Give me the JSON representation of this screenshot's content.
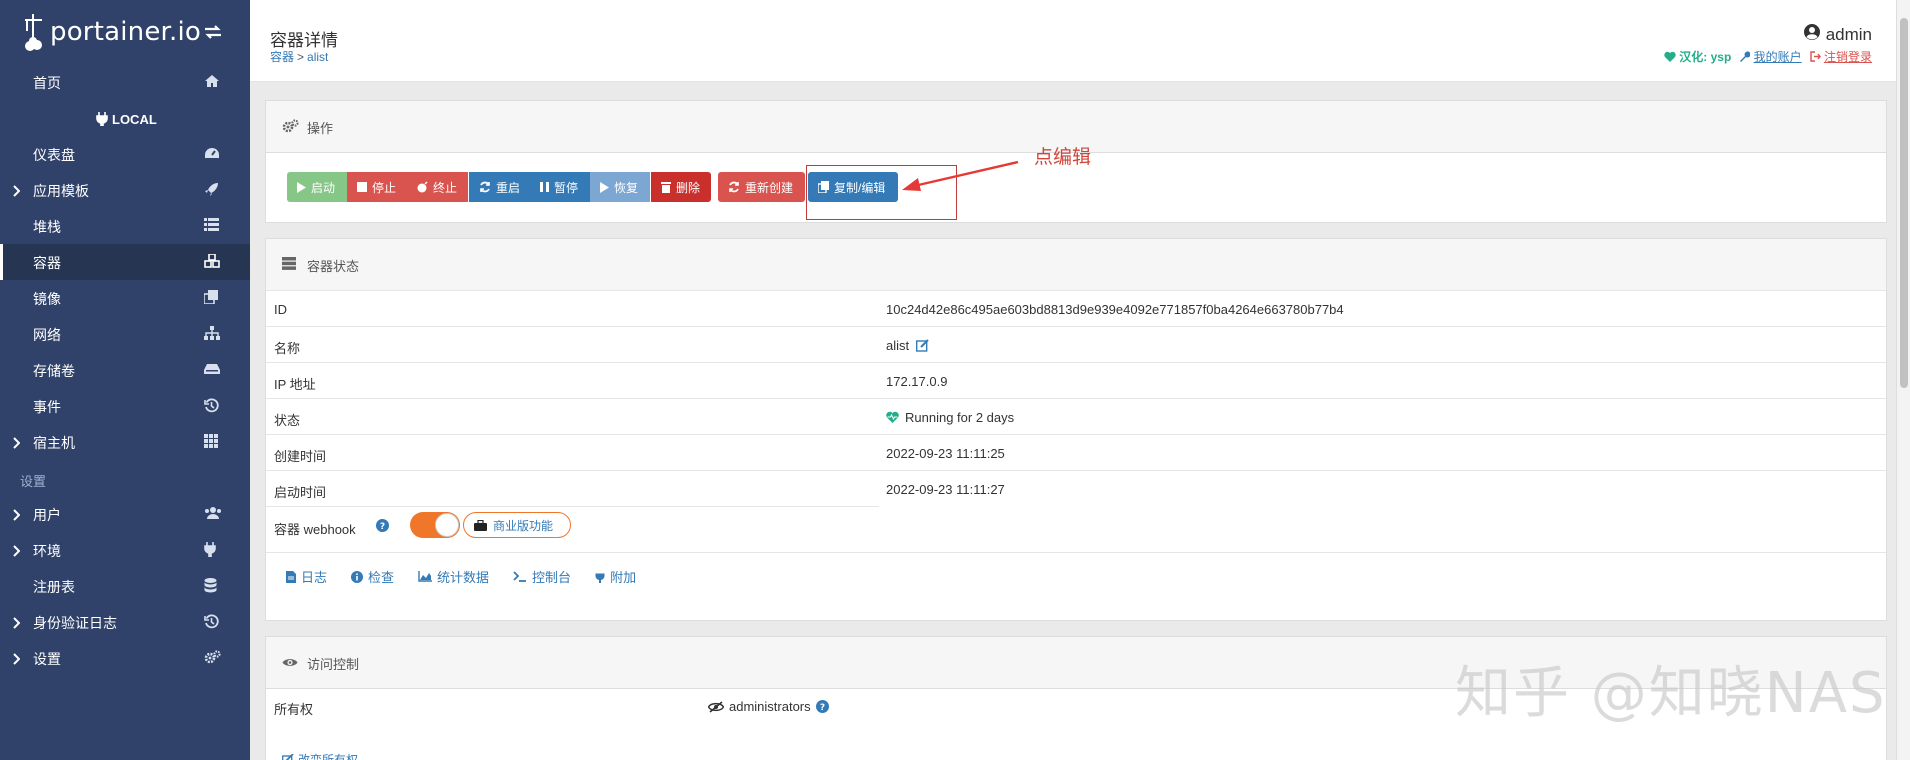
{
  "sidebar": {
    "logo_text": "portainer.io",
    "items_top": [
      {
        "label": "首页",
        "icon": "home-icon"
      }
    ],
    "endpoint_header": "LOCAL",
    "items": [
      {
        "label": "仪表盘",
        "icon": "dashboard-icon",
        "caret": false
      },
      {
        "label": "应用模板",
        "icon": "rocket-icon",
        "caret": true
      },
      {
        "label": "堆栈",
        "icon": "list-icon",
        "caret": false
      },
      {
        "label": "容器",
        "icon": "cubes-icon",
        "caret": false,
        "active": true
      },
      {
        "label": "镜像",
        "icon": "clone-icon",
        "caret": false
      },
      {
        "label": "网络",
        "icon": "sitemap-icon",
        "caret": false
      },
      {
        "label": "存储卷",
        "icon": "hdd-icon",
        "caret": false
      },
      {
        "label": "事件",
        "icon": "history-icon",
        "caret": false
      },
      {
        "label": "宿主机",
        "icon": "grid-icon",
        "caret": true
      }
    ],
    "settings_title": "设置",
    "settings_items": [
      {
        "label": "用户",
        "icon": "users-icon",
        "caret": true
      },
      {
        "label": "环境",
        "icon": "plug-icon",
        "caret": true
      },
      {
        "label": "注册表",
        "icon": "database-icon",
        "caret": false
      },
      {
        "label": "身份验证日志",
        "icon": "history-icon",
        "caret": true
      },
      {
        "label": "设置",
        "icon": "cogs-icon",
        "caret": true
      }
    ]
  },
  "header": {
    "title": "容器详情",
    "breadcrumb_root": "容器",
    "breadcrumb_sep": ">",
    "breadcrumb_current": "alist",
    "user": "admin",
    "translation": "汉化: ysp",
    "my_account": "我的账户",
    "logout": "注销登录"
  },
  "actions": {
    "title": "操作",
    "buttons": {
      "start": "启动",
      "stop": "停止",
      "kill": "终止",
      "restart": "重启",
      "pause": "暂停",
      "resume": "恢复",
      "remove": "删除",
      "recreate": "重新创建",
      "duplicate": "复制/编辑"
    }
  },
  "annotation": "点编辑",
  "status": {
    "title": "容器状态",
    "rows": [
      {
        "key": "ID",
        "value": "10c24d42e86c495ae603bd8813d9e939e4092e771857f0ba4264e663780b77b4"
      },
      {
        "key": "名称",
        "value": "alist"
      },
      {
        "key": "IP 地址",
        "value": "172.17.0.9"
      },
      {
        "key": "状态",
        "value": "Running for 2 days"
      },
      {
        "key": "创建时间",
        "value": "2022-09-23 11:11:25"
      },
      {
        "key": "启动时间",
        "value": "2022-09-23 11:11:27"
      }
    ],
    "webhook_label": "容器 webhook",
    "business_feature": "商业版功能",
    "tabs": [
      "日志",
      "检查",
      "统计数据",
      "控制台",
      "附加"
    ]
  },
  "access": {
    "title": "访问控制",
    "ownership_label": "所有权",
    "ownership_value": "administrators",
    "change_ownership": "改变所有权"
  },
  "watermark": "知乎 @知晓NAS",
  "colors": {
    "sidebar_bg": "#30426a",
    "sidebar_active": "#253552",
    "primary": "#337ab7",
    "danger": "#d9534f",
    "success": "#86c686",
    "running": "#23ae89",
    "toggle": "#f0762a"
  }
}
